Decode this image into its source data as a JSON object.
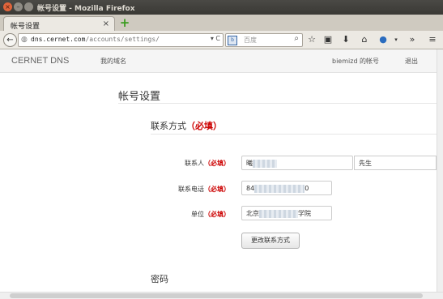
{
  "window": {
    "title": "帐号设置 - Mozilla Firefox"
  },
  "tab": {
    "title": "帐号设置",
    "close": "×",
    "new_tab": "+"
  },
  "navbar": {
    "back": "←",
    "url_host": "dns.cernet.com",
    "url_path": "/accounts/settings/",
    "url_controls": "▾ C",
    "search_engine": "b",
    "search_placeholder": "百度",
    "search_go": "🔍",
    "icons": [
      "star-icon",
      "bookmarks-icon",
      "download-icon",
      "home-icon",
      "addon-icon",
      "overflow-icon",
      "menu-icon"
    ]
  },
  "site": {
    "brand": "CERNET DNS",
    "nav_domains": "我的域名",
    "user_account": "biemizd 的帐号",
    "logout": "退出"
  },
  "page": {
    "heading": "帐号设置",
    "contact_section": "联系方式",
    "required": "（必填）",
    "contact_label": "联系人",
    "contact_value": "曦",
    "title_value": "先生",
    "phone_label": "联系电话",
    "phone_prefix": "84",
    "phone_suffix": "0",
    "unit_label": "单位",
    "unit_prefix": "北京",
    "unit_suffix": "学院",
    "submit": "更改联系方式",
    "password_section": "密码"
  }
}
